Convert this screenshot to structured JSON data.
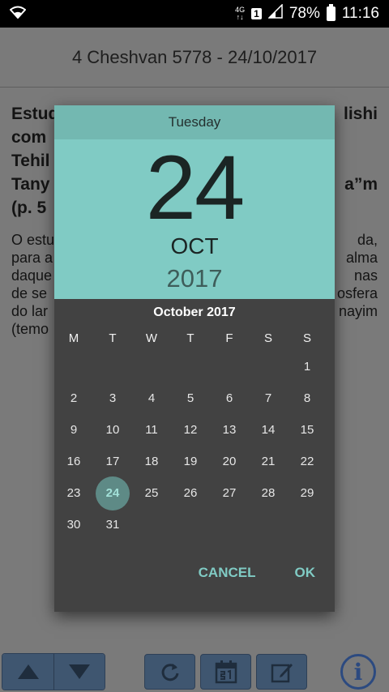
{
  "statusbar": {
    "network": "4G",
    "network_sub": "↑↓",
    "sim": "1",
    "battery": "78%",
    "time": "11:16"
  },
  "app": {
    "header_title": "4 Cheshvan 5778 - 24/10/2017",
    "article_bold_lines": [
      "Estud",
      "com ",
      "Tehil",
      "Tany",
      "(p. 5"
    ],
    "article_bold_right": [
      "lishi",
      "",
      "",
      "a”m",
      ""
    ],
    "article_body_left": [
      "O estu",
      "para a",
      "daque",
      "de se",
      "do lar",
      "(temo"
    ],
    "article_body_right": [
      "da,",
      "alma",
      "nas",
      "osfera",
      "nayim",
      ""
    ]
  },
  "dialog": {
    "day_of_week": "Tuesday",
    "day_number": "24",
    "month": "OCT",
    "year": "2017",
    "calendar_title": "October 2017",
    "weekdays": [
      "M",
      "T",
      "W",
      "T",
      "F",
      "S",
      "S"
    ],
    "days": [
      "",
      "",
      "",
      "",
      "",
      "",
      "1",
      "2",
      "3",
      "4",
      "5",
      "6",
      "7",
      "8",
      "9",
      "10",
      "11",
      "12",
      "13",
      "14",
      "15",
      "16",
      "17",
      "18",
      "19",
      "20",
      "21",
      "22",
      "23",
      "24",
      "25",
      "26",
      "27",
      "28",
      "29",
      "30",
      "31",
      "",
      "",
      "",
      "",
      ""
    ],
    "selected_day": "24",
    "cancel_label": "CANCEL",
    "ok_label": "OK"
  },
  "colors": {
    "accent": "#80cbc4",
    "dialog_bg": "#424242",
    "toolbar_button": "#3f5670"
  },
  "icons": {
    "up": "arrow-up-icon",
    "down": "arrow-down-icon",
    "refresh": "refresh-icon",
    "calendar": "calendar-icon",
    "edit": "edit-icon",
    "info": "info-icon"
  }
}
